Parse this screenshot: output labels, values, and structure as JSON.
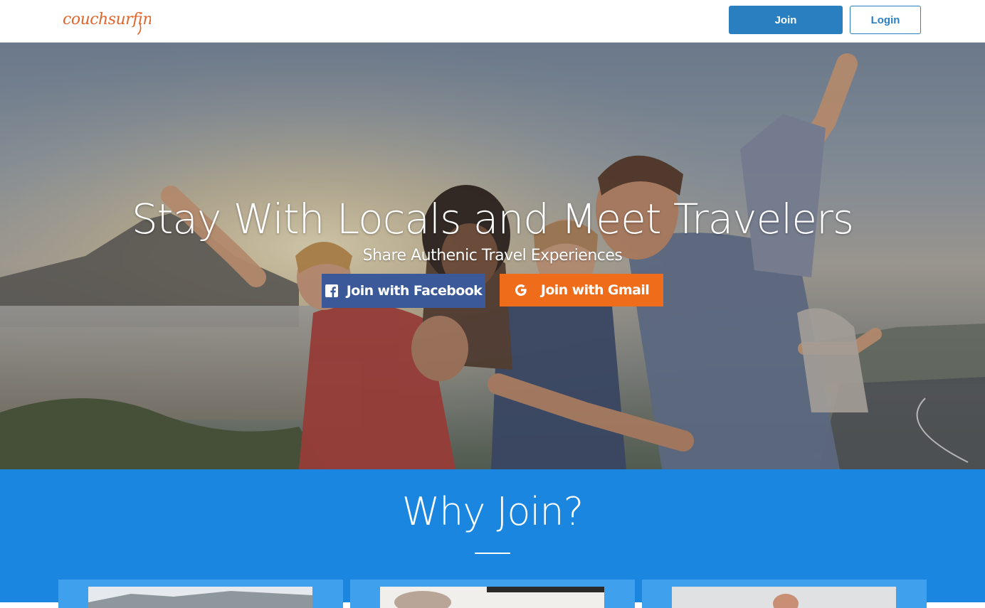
{
  "header": {
    "logo_text": "couchsurfing",
    "join_label": "Join",
    "login_label": "Login"
  },
  "hero": {
    "title": "Stay With Locals and Meet Travelers",
    "subtitle": "Share Authenic Travel Experiences",
    "facebook_label": "Join with Facebook",
    "gmail_label": "Join with Gmail",
    "facebook_icon": "facebook-icon",
    "gmail_icon": "google-icon"
  },
  "why": {
    "title": "Why Join?"
  },
  "colors": {
    "brand_orange": "#e0652a",
    "header_blue": "#2a7fc1",
    "facebook_blue": "#3b5998",
    "gmail_orange": "#ef6c1a",
    "section_blue": "#1a86e0",
    "card_blue": "#3fa0ee"
  }
}
